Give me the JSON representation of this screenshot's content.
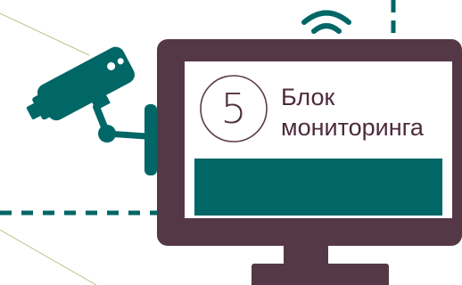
{
  "step": {
    "number": "5",
    "label_line1": "Блок",
    "label_line2": "мониторинга"
  },
  "colors": {
    "monitor_frame": "#553845",
    "teal": "#006666",
    "screen_bg": "#ffffff",
    "thin_line": "#b8c48a",
    "number_circle": "#5a3c4a"
  },
  "icons": {
    "camera": "security-camera-icon",
    "wifi": "wifi-icon",
    "monitor": "monitor-icon"
  }
}
